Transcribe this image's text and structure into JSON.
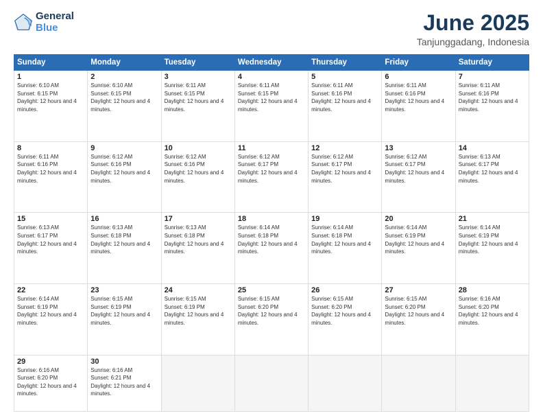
{
  "header": {
    "logo_line1": "General",
    "logo_line2": "Blue",
    "title": "June 2025",
    "subtitle": "Tanjunggadang, Indonesia"
  },
  "days_of_week": [
    "Sunday",
    "Monday",
    "Tuesday",
    "Wednesday",
    "Thursday",
    "Friday",
    "Saturday"
  ],
  "weeks": [
    [
      {
        "day": "1",
        "sunrise": "6:10 AM",
        "sunset": "6:15 PM",
        "daylight": "12 hours and 4 minutes."
      },
      {
        "day": "2",
        "sunrise": "6:10 AM",
        "sunset": "6:15 PM",
        "daylight": "12 hours and 4 minutes."
      },
      {
        "day": "3",
        "sunrise": "6:11 AM",
        "sunset": "6:15 PM",
        "daylight": "12 hours and 4 minutes."
      },
      {
        "day": "4",
        "sunrise": "6:11 AM",
        "sunset": "6:15 PM",
        "daylight": "12 hours and 4 minutes."
      },
      {
        "day": "5",
        "sunrise": "6:11 AM",
        "sunset": "6:16 PM",
        "daylight": "12 hours and 4 minutes."
      },
      {
        "day": "6",
        "sunrise": "6:11 AM",
        "sunset": "6:16 PM",
        "daylight": "12 hours and 4 minutes."
      },
      {
        "day": "7",
        "sunrise": "6:11 AM",
        "sunset": "6:16 PM",
        "daylight": "12 hours and 4 minutes."
      }
    ],
    [
      {
        "day": "8",
        "sunrise": "6:11 AM",
        "sunset": "6:16 PM",
        "daylight": "12 hours and 4 minutes."
      },
      {
        "day": "9",
        "sunrise": "6:12 AM",
        "sunset": "6:16 PM",
        "daylight": "12 hours and 4 minutes."
      },
      {
        "day": "10",
        "sunrise": "6:12 AM",
        "sunset": "6:16 PM",
        "daylight": "12 hours and 4 minutes."
      },
      {
        "day": "11",
        "sunrise": "6:12 AM",
        "sunset": "6:17 PM",
        "daylight": "12 hours and 4 minutes."
      },
      {
        "day": "12",
        "sunrise": "6:12 AM",
        "sunset": "6:17 PM",
        "daylight": "12 hours and 4 minutes."
      },
      {
        "day": "13",
        "sunrise": "6:12 AM",
        "sunset": "6:17 PM",
        "daylight": "12 hours and 4 minutes."
      },
      {
        "day": "14",
        "sunrise": "6:13 AM",
        "sunset": "6:17 PM",
        "daylight": "12 hours and 4 minutes."
      }
    ],
    [
      {
        "day": "15",
        "sunrise": "6:13 AM",
        "sunset": "6:17 PM",
        "daylight": "12 hours and 4 minutes."
      },
      {
        "day": "16",
        "sunrise": "6:13 AM",
        "sunset": "6:18 PM",
        "daylight": "12 hours and 4 minutes."
      },
      {
        "day": "17",
        "sunrise": "6:13 AM",
        "sunset": "6:18 PM",
        "daylight": "12 hours and 4 minutes."
      },
      {
        "day": "18",
        "sunrise": "6:14 AM",
        "sunset": "6:18 PM",
        "daylight": "12 hours and 4 minutes."
      },
      {
        "day": "19",
        "sunrise": "6:14 AM",
        "sunset": "6:18 PM",
        "daylight": "12 hours and 4 minutes."
      },
      {
        "day": "20",
        "sunrise": "6:14 AM",
        "sunset": "6:19 PM",
        "daylight": "12 hours and 4 minutes."
      },
      {
        "day": "21",
        "sunrise": "6:14 AM",
        "sunset": "6:19 PM",
        "daylight": "12 hours and 4 minutes."
      }
    ],
    [
      {
        "day": "22",
        "sunrise": "6:14 AM",
        "sunset": "6:19 PM",
        "daylight": "12 hours and 4 minutes."
      },
      {
        "day": "23",
        "sunrise": "6:15 AM",
        "sunset": "6:19 PM",
        "daylight": "12 hours and 4 minutes."
      },
      {
        "day": "24",
        "sunrise": "6:15 AM",
        "sunset": "6:19 PM",
        "daylight": "12 hours and 4 minutes."
      },
      {
        "day": "25",
        "sunrise": "6:15 AM",
        "sunset": "6:20 PM",
        "daylight": "12 hours and 4 minutes."
      },
      {
        "day": "26",
        "sunrise": "6:15 AM",
        "sunset": "6:20 PM",
        "daylight": "12 hours and 4 minutes."
      },
      {
        "day": "27",
        "sunrise": "6:15 AM",
        "sunset": "6:20 PM",
        "daylight": "12 hours and 4 minutes."
      },
      {
        "day": "28",
        "sunrise": "6:16 AM",
        "sunset": "6:20 PM",
        "daylight": "12 hours and 4 minutes."
      }
    ],
    [
      {
        "day": "29",
        "sunrise": "6:16 AM",
        "sunset": "6:20 PM",
        "daylight": "12 hours and 4 minutes."
      },
      {
        "day": "30",
        "sunrise": "6:16 AM",
        "sunset": "6:21 PM",
        "daylight": "12 hours and 4 minutes."
      },
      null,
      null,
      null,
      null,
      null
    ]
  ]
}
